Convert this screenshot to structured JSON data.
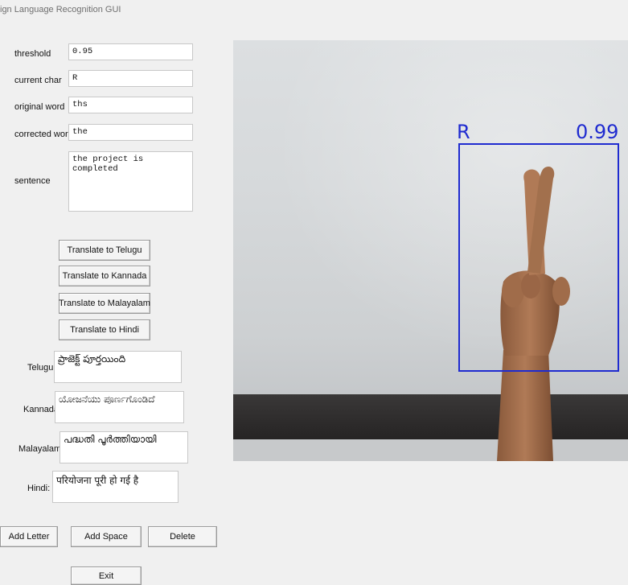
{
  "window": {
    "title": "ign Language Recognition GUI"
  },
  "fields": {
    "threshold": {
      "label": "threshold",
      "value": "0.95"
    },
    "current_char": {
      "label": "current char",
      "value": "R"
    },
    "original_word": {
      "label": "original word",
      "value": "ths"
    },
    "corrected_word": {
      "label": "corrected word",
      "value": "the"
    },
    "sentence": {
      "label": "sentence",
      "value": "the project is completed"
    }
  },
  "translate_buttons": {
    "telugu": "Translate to Telugu",
    "kannada": "Translate to Kannada",
    "malayalam": "Translate to Malayalam",
    "hindi": "Translate to Hindi"
  },
  "translations": {
    "telugu": {
      "label": "Telugu:",
      "value": "ప్రాజెక్ట్ పూర్తయింది"
    },
    "kannada": {
      "label": "Kannada:",
      "value": "ಯೋಜನೆಯು ಪೂರ್ಣಗೊಂಡಿದೆ"
    },
    "malayalam": {
      "label": "Malayalam:",
      "value": "പദ്ധതി പൂർത്തിയായി"
    },
    "hindi": {
      "label": "Hindi:",
      "value": "परियोजना पूरी हो गई है"
    }
  },
  "actions": {
    "add_letter": "Add Letter",
    "add_space": "Add Space",
    "delete": "Delete",
    "exit": "Exit"
  },
  "detection": {
    "label": "R",
    "confidence": "0.99",
    "color": "#1f2bd0"
  }
}
